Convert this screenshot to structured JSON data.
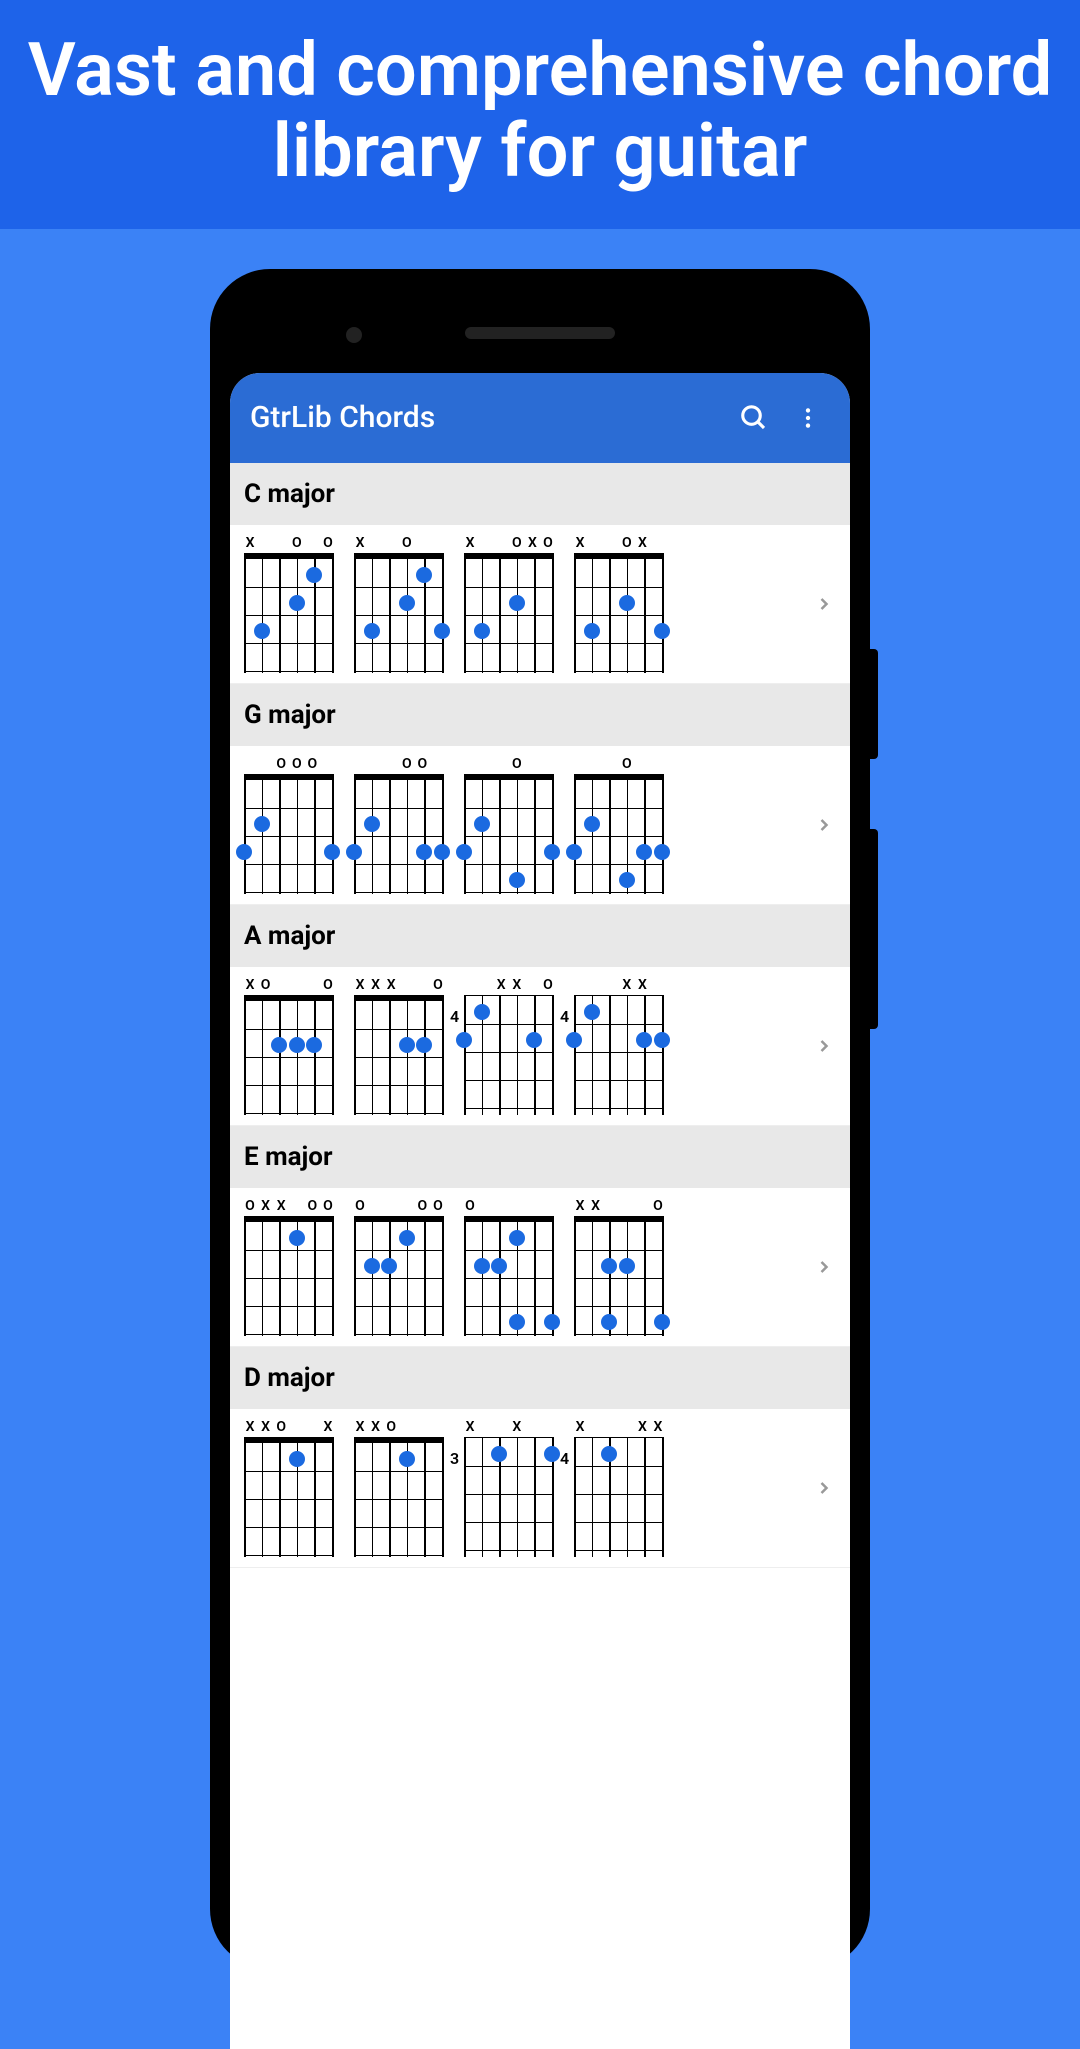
{
  "promo_headline": "Vast and comprehensive chord library for guitar",
  "appbar": {
    "title": "GtrLib Chords"
  },
  "sections": [
    {
      "name": "C major",
      "chords": [
        {
          "markers": [
            "X",
            "",
            "",
            "O",
            "",
            "O"
          ],
          "dots": [
            [
              4,
              1
            ],
            [
              3,
              2
            ],
            [
              1,
              3
            ]
          ]
        },
        {
          "markers": [
            "X",
            "",
            "",
            "O",
            "",
            ""
          ],
          "dots": [
            [
              4,
              1
            ],
            [
              3,
              2
            ],
            [
              1,
              3
            ],
            [
              5,
              3
            ]
          ]
        },
        {
          "markers": [
            "X",
            "",
            "",
            "O",
            "X",
            "O"
          ],
          "dots": [
            [
              3,
              2
            ],
            [
              1,
              3
            ]
          ]
        },
        {
          "markers": [
            "X",
            "",
            "",
            "O",
            "X",
            ""
          ],
          "dots": [
            [
              3,
              2
            ],
            [
              1,
              3
            ],
            [
              5,
              3
            ]
          ]
        }
      ]
    },
    {
      "name": "G major",
      "chords": [
        {
          "markers": [
            "",
            "",
            "O",
            "O",
            "O",
            ""
          ],
          "dots": [
            [
              1,
              2
            ],
            [
              0,
              3
            ],
            [
              5,
              3
            ]
          ]
        },
        {
          "markers": [
            "",
            "",
            "",
            "O",
            "O",
            ""
          ],
          "dots": [
            [
              1,
              2
            ],
            [
              0,
              3
            ],
            [
              4,
              3
            ],
            [
              5,
              3
            ]
          ]
        },
        {
          "markers": [
            "",
            "",
            "",
            "O",
            "",
            ""
          ],
          "dots": [
            [
              1,
              2
            ],
            [
              0,
              3
            ],
            [
              5,
              3
            ],
            [
              3,
              4
            ]
          ]
        },
        {
          "markers": [
            "",
            "",
            "",
            "O",
            "",
            ""
          ],
          "dots": [
            [
              1,
              2
            ],
            [
              0,
              3
            ],
            [
              4,
              3
            ],
            [
              5,
              3
            ],
            [
              3,
              4
            ]
          ]
        }
      ]
    },
    {
      "name": "A major",
      "chords": [
        {
          "markers": [
            "X",
            "O",
            "",
            "",
            "",
            "O"
          ],
          "dots": [
            [
              2,
              2
            ],
            [
              3,
              2
            ],
            [
              4,
              2
            ]
          ]
        },
        {
          "markers": [
            "X",
            "X",
            "X",
            "",
            "",
            "O"
          ],
          "dots": [
            [
              3,
              2
            ],
            [
              4,
              2
            ]
          ]
        },
        {
          "markers": [
            "",
            "",
            "X",
            "X",
            "",
            "O"
          ],
          "fret": 4,
          "dots": [
            [
              1,
              1
            ],
            [
              0,
              2
            ],
            [
              4,
              2
            ]
          ]
        },
        {
          "markers": [
            "",
            "",
            "",
            "X",
            "X",
            ""
          ],
          "fret": 4,
          "dots": [
            [
              1,
              1
            ],
            [
              0,
              2
            ],
            [
              4,
              2
            ],
            [
              5,
              2
            ]
          ]
        }
      ]
    },
    {
      "name": "E major",
      "chords": [
        {
          "markers": [
            "O",
            "X",
            "X",
            "",
            "O",
            "O"
          ],
          "dots": [
            [
              3,
              1
            ]
          ]
        },
        {
          "markers": [
            "O",
            "",
            "",
            "",
            "O",
            "O"
          ],
          "dots": [
            [
              3,
              1
            ],
            [
              1,
              2
            ],
            [
              2,
              2
            ]
          ]
        },
        {
          "markers": [
            "O",
            "",
            "",
            "",
            "",
            ""
          ],
          "dots": [
            [
              3,
              1
            ],
            [
              1,
              2
            ],
            [
              2,
              2
            ],
            [
              3,
              4
            ],
            [
              5,
              4
            ]
          ]
        },
        {
          "markers": [
            "X",
            "X",
            "",
            "",
            "",
            "O"
          ],
          "dots": [
            [
              2,
              2
            ],
            [
              3,
              2
            ],
            [
              2,
              4
            ],
            [
              5,
              4
            ]
          ]
        }
      ]
    },
    {
      "name": "D major",
      "chords": [
        {
          "markers": [
            "X",
            "X",
            "O",
            "",
            "",
            "X"
          ],
          "dots": [
            [
              3,
              1
            ]
          ]
        },
        {
          "markers": [
            "X",
            "X",
            "O",
            "",
            "",
            ""
          ],
          "dots": [
            [
              3,
              1
            ]
          ]
        },
        {
          "markers": [
            "X",
            "",
            "",
            "X",
            "",
            ""
          ],
          "fret": 3,
          "dots": [
            [
              2,
              1
            ],
            [
              5,
              1
            ]
          ]
        },
        {
          "markers": [
            "X",
            "",
            "",
            "",
            "X",
            "X"
          ],
          "fret": 4,
          "dots": [
            [
              2,
              1
            ]
          ]
        }
      ]
    }
  ]
}
